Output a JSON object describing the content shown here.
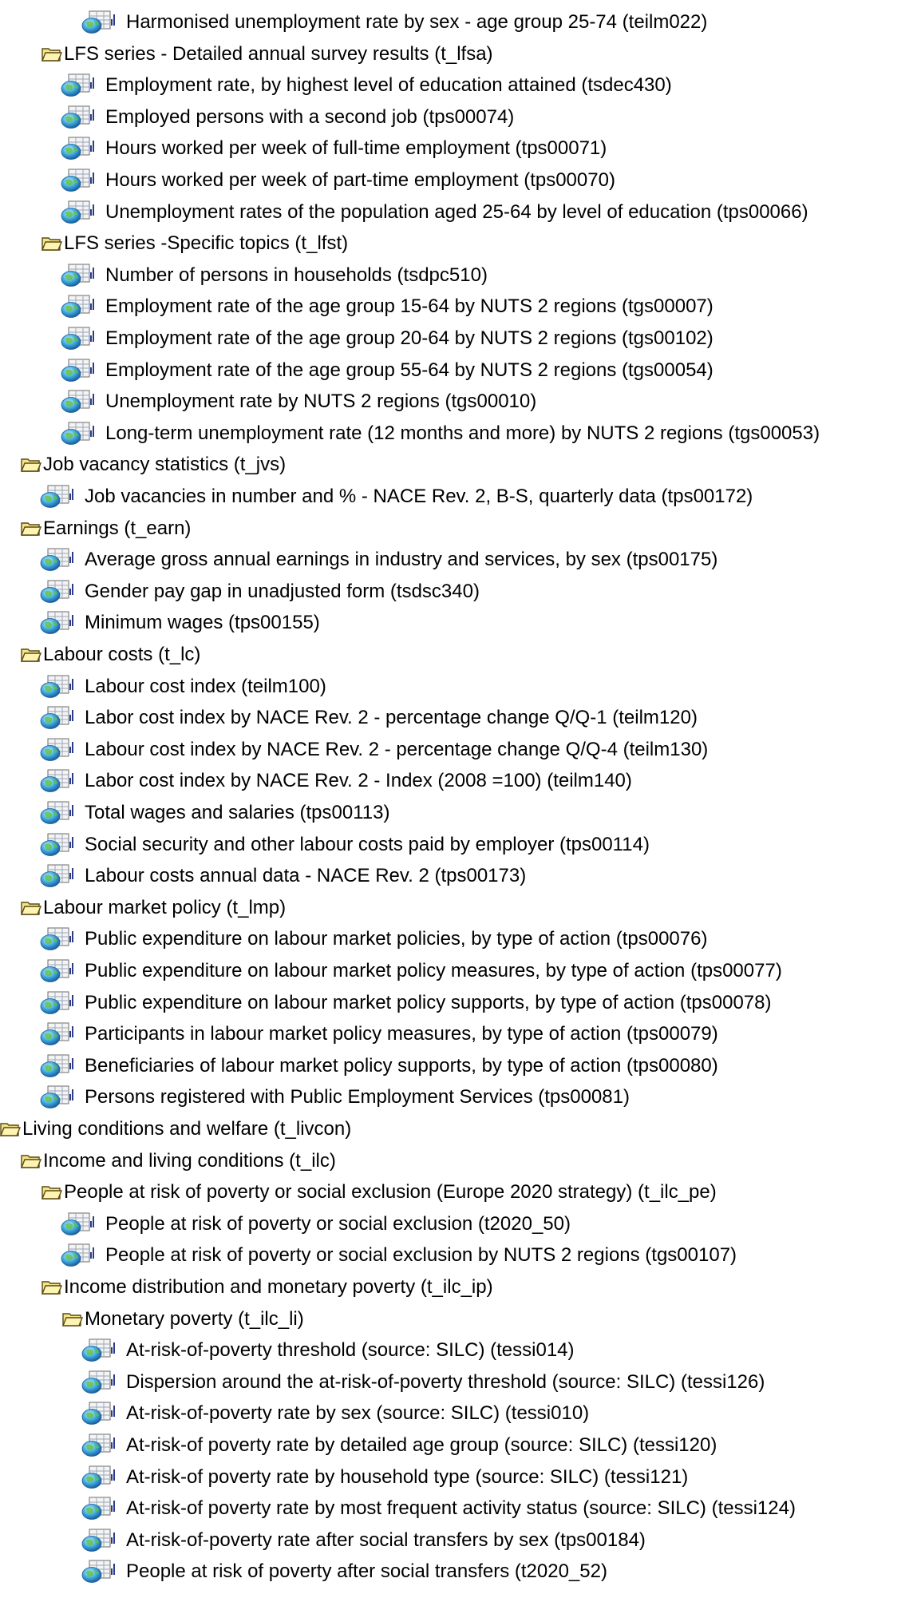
{
  "tree": [
    {
      "kind": "table",
      "level": 4,
      "label": "Harmonised unemployment rate by sex - age group 25-74 (teilm022)"
    },
    {
      "kind": "folder",
      "level": 3,
      "label": "LFS series - Detailed annual survey results (t_lfsa)"
    },
    {
      "kind": "table",
      "level": 3,
      "label": "Employment rate, by highest level of education attained  (tsdec430)"
    },
    {
      "kind": "table",
      "level": 3,
      "label": "Employed persons with a second job (tps00074)"
    },
    {
      "kind": "table",
      "level": 3,
      "label": "Hours worked per week of full-time employment (tps00071)"
    },
    {
      "kind": "table",
      "level": 3,
      "label": "Hours worked per week of part-time employment (tps00070)"
    },
    {
      "kind": "table",
      "level": 3,
      "label": "Unemployment rates of the population aged 25-64 by level of education (tps00066)"
    },
    {
      "kind": "folder",
      "level": 3,
      "label": "LFS series -Specific topics (t_lfst)"
    },
    {
      "kind": "table",
      "level": 3,
      "label": "Number of persons in households (tsdpc510)"
    },
    {
      "kind": "table",
      "level": 3,
      "label": "Employment rate of the age group 15-64 by NUTS 2 regions (tgs00007)"
    },
    {
      "kind": "table",
      "level": 3,
      "label": "Employment rate of the age group 20-64 by NUTS 2 regions (tgs00102)"
    },
    {
      "kind": "table",
      "level": 3,
      "label": "Employment rate of the age group 55-64  by NUTS 2 regions (tgs00054)"
    },
    {
      "kind": "table",
      "level": 3,
      "label": "Unemployment rate by NUTS 2 regions (tgs00010)"
    },
    {
      "kind": "table",
      "level": 3,
      "label": "Long-term unemployment rate (12 months and more) by NUTS 2 regions (tgs00053)"
    },
    {
      "kind": "folder",
      "level": 2,
      "label": "Job vacancy statistics (t_jvs)"
    },
    {
      "kind": "table",
      "level": 2,
      "label": "Job vacancies in number and % - NACE Rev. 2, B-S, quarterly data (tps00172)"
    },
    {
      "kind": "folder",
      "level": 2,
      "label": "Earnings (t_earn)"
    },
    {
      "kind": "table",
      "level": 2,
      "label": "Average gross annual earnings in industry and services, by sex (tps00175)"
    },
    {
      "kind": "table",
      "level": 2,
      "label": "Gender pay gap in unadjusted form (tsdsc340)"
    },
    {
      "kind": "table",
      "level": 2,
      "label": "Minimum wages (tps00155)"
    },
    {
      "kind": "folder",
      "level": 2,
      "label": "Labour costs  (t_lc)"
    },
    {
      "kind": "table",
      "level": 2,
      "label": "Labour cost index (teilm100)"
    },
    {
      "kind": "table",
      "level": 2,
      "label": "Labor cost index by NACE Rev. 2 - percentage change  Q/Q-1 (teilm120)"
    },
    {
      "kind": "table",
      "level": 2,
      "label": "Labour cost index by NACE Rev. 2 - percentage change Q/Q-4 (teilm130)"
    },
    {
      "kind": "table",
      "level": 2,
      "label": "Labor cost index by NACE Rev. 2 - Index (2008 =100) (teilm140)"
    },
    {
      "kind": "table",
      "level": 2,
      "label": "Total wages and salaries (tps00113)"
    },
    {
      "kind": "table",
      "level": 2,
      "label": "Social security and other labour costs paid by employer (tps00114)"
    },
    {
      "kind": "table",
      "level": 2,
      "label": "Labour costs annual data - NACE Rev. 2 (tps00173)"
    },
    {
      "kind": "folder",
      "level": 2,
      "label": "Labour market policy (t_lmp)"
    },
    {
      "kind": "table",
      "level": 2,
      "label": "Public expenditure on labour market policies, by type of action (tps00076)"
    },
    {
      "kind": "table",
      "level": 2,
      "label": "Public expenditure on labour market policy measures, by type of action (tps00077)"
    },
    {
      "kind": "table",
      "level": 2,
      "label": "Public expenditure on labour market policy supports, by type of action (tps00078)"
    },
    {
      "kind": "table",
      "level": 2,
      "label": "Participants in labour market policy measures, by type of action  (tps00079)"
    },
    {
      "kind": "table",
      "level": 2,
      "label": "Beneficiaries of labour market policy supports, by type of action  (tps00080)"
    },
    {
      "kind": "table",
      "level": 2,
      "label": "Persons registered with Public Employment Services  (tps00081)"
    },
    {
      "kind": "folder",
      "level": 1,
      "label": "Living conditions and welfare (t_livcon)"
    },
    {
      "kind": "folder",
      "level": 2,
      "label": "Income and living conditions (t_ilc)"
    },
    {
      "kind": "folder",
      "level": 3,
      "label": "People at risk of poverty or social exclusion (Europe 2020 strategy) (t_ilc_pe)"
    },
    {
      "kind": "table",
      "level": 3,
      "label": "People at risk of poverty or social exclusion (t2020_50)"
    },
    {
      "kind": "table",
      "level": 3,
      "label": "People at risk of poverty or social exclusion by NUTS 2 regions (tgs00107)"
    },
    {
      "kind": "folder",
      "level": 3,
      "label": "Income distribution and monetary poverty (t_ilc_ip)"
    },
    {
      "kind": "folder",
      "level": 4,
      "label": "Monetary poverty (t_ilc_li)"
    },
    {
      "kind": "table",
      "level": 4,
      "label": "At-risk-of-poverty threshold (source: SILC) (tessi014)"
    },
    {
      "kind": "table",
      "level": 4,
      "label": "Dispersion around the at-risk-of-poverty threshold (source: SILC) (tessi126)"
    },
    {
      "kind": "table",
      "level": 4,
      "label": "At-risk-of-poverty rate by sex (source: SILC) (tessi010)"
    },
    {
      "kind": "table",
      "level": 4,
      "label": "At-risk-of poverty rate by detailed age group (source: SILC) (tessi120)"
    },
    {
      "kind": "table",
      "level": 4,
      "label": "At-risk-of poverty rate by household type (source: SILC) (tessi121)"
    },
    {
      "kind": "table",
      "level": 4,
      "label": "At-risk-of poverty rate by most frequent activity status (source: SILC) (tessi124)"
    },
    {
      "kind": "table",
      "level": 4,
      "label": "At-risk-of-poverty rate after social transfers by sex (tps00184)"
    },
    {
      "kind": "table",
      "level": 4,
      "label": "People at risk of poverty after social transfers (t2020_52)"
    }
  ]
}
